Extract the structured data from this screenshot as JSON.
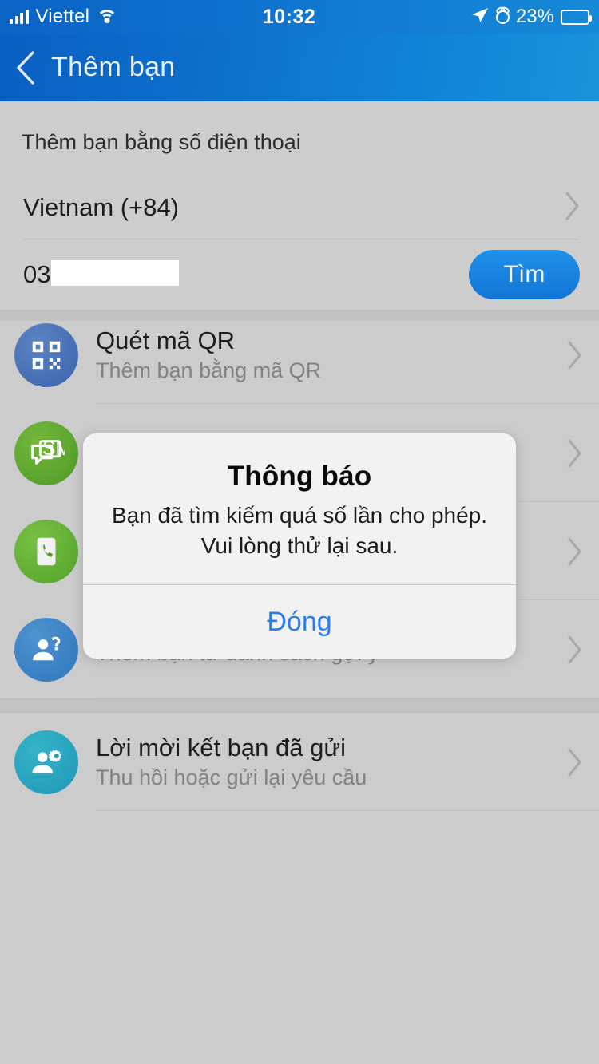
{
  "status_bar": {
    "carrier": "Viettel",
    "time": "10:32",
    "battery_percent": "23%",
    "icons": [
      "signal-bars-icon",
      "wifi-icon",
      "location-arrow-icon",
      "alarm-clock-icon",
      "battery-icon"
    ]
  },
  "nav": {
    "title": "Thêm bạn",
    "back_icon": "chevron-left-icon"
  },
  "search_panel": {
    "heading": "Thêm bạn bằng số điện thoại",
    "country": "Vietnam (+84)",
    "country_chevron": "chevron-right-icon",
    "phone_prefix": "03",
    "phone_redacted": true,
    "search_button": "Tìm"
  },
  "list": {
    "items": [
      {
        "icon": "qr-code-icon",
        "icon_color": "#3b63ab",
        "title": "Quét mã QR",
        "subtitle": "Thêm bạn bằng mã QR",
        "chevron": "chevron-right-icon"
      },
      {
        "icon": "sms-message-icon",
        "icon_color": "#4e9a27",
        "title": "",
        "subtitle": "",
        "chevron": "chevron-right-icon"
      },
      {
        "icon": "phone-contact-icon",
        "icon_color": "#53a32b",
        "title": "",
        "subtitle": "",
        "chevron": "chevron-right-icon"
      },
      {
        "icon": "person-question-icon",
        "icon_color": "#2d77bd",
        "title": "",
        "subtitle": "Thêm bạn từ danh sách gợi ý",
        "chevron": "chevron-right-icon"
      }
    ],
    "section2": [
      {
        "icon": "person-gear-icon",
        "icon_color": "#1f97b5",
        "title": "Lời mời kết bạn đã gửi",
        "subtitle": "Thu hồi hoặc gửi lại yêu cầu",
        "chevron": "chevron-right-icon"
      }
    ]
  },
  "dialog": {
    "title": "Thông báo",
    "message_line1": "Bạn đã tìm kiếm quá số lần cho phép.",
    "message_line2": "Vui lòng thử lại sau.",
    "close_button": "Đóng"
  },
  "colors": {
    "header_blue_dark": "#0a5fc2",
    "header_blue_light": "#1a93db",
    "accent_blue": "#1276d6",
    "dialog_link": "#2a7ef0",
    "page_bg": "#cccccc"
  }
}
